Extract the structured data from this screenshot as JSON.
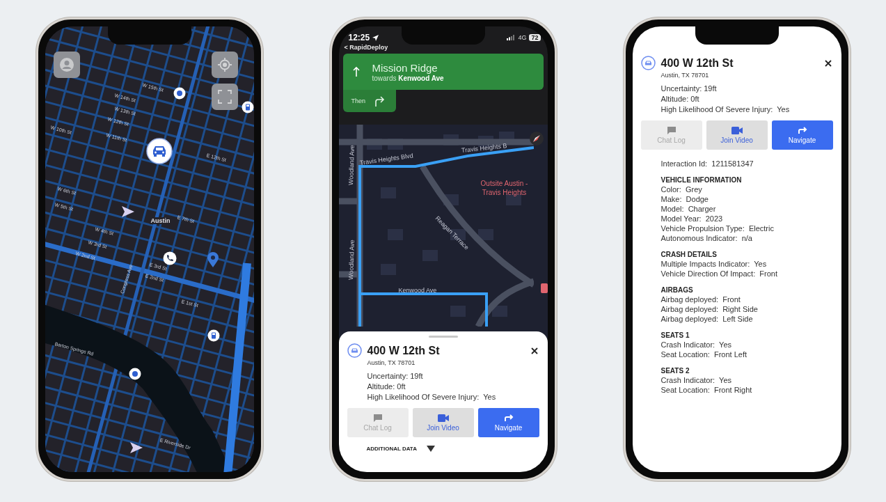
{
  "map_phone": {
    "controls": [
      {
        "kind": "profile"
      },
      {
        "kind": "locate"
      },
      {
        "kind": "fullscreen"
      }
    ],
    "markers": [
      {
        "kind": "fuel"
      },
      {
        "kind": "dot"
      },
      {
        "kind": "car"
      },
      {
        "kind": "arrow"
      },
      {
        "kind": "phone"
      },
      {
        "kind": "pin"
      },
      {
        "kind": "fuel"
      },
      {
        "kind": "dot"
      },
      {
        "kind": "arrow"
      }
    ],
    "street_labels": [
      "W 15th St",
      "W 14th St",
      "W 13th St",
      "W 12th St",
      "W 11th St",
      "W 10th St",
      "W 6th St",
      "W 5th St",
      "Austin",
      "E 7th St",
      "W 4th St",
      "W 3rd St",
      "W 2nd St",
      "E 3rd St",
      "E 2nd St",
      "E 1st St",
      "E 12th St",
      "Congress Ave",
      "Barton Springs Rd",
      "E Riverside Dr"
    ]
  },
  "navigation_phone": {
    "status_bar": {
      "time": "12:25",
      "network": "4G",
      "battery": "72"
    },
    "back_link": "< RapidDeploy",
    "maneuver": {
      "street": "Mission Ridge",
      "towards": "towards **Kenwood Ave**"
    },
    "next_maneuver": {
      "label": "Then"
    },
    "map_labels": [
      "Travis Heights Blvd",
      "Travis Heights B",
      "Woodland Ave",
      "Woodland Ave",
      "Reagan Terrace",
      "Outsite Austin - Travis Heights",
      "Kenwood Ave"
    ],
    "sheet": {
      "title": "400 W 12th St",
      "subtitle": "Austin, TX 78701",
      "details": [
        "Uncertainty: 19ft",
        "Altitude: 0ft",
        "High Likelihood Of Severe Injury:  Yes"
      ],
      "buttons": [
        {
          "kind": "chat",
          "label": "Chat Log",
          "disabled": true
        },
        {
          "kind": "video",
          "label": "Join Video",
          "disabled": false
        },
        {
          "kind": "navigate",
          "label": "Navigate",
          "disabled": false
        }
      ],
      "additional_data": {
        "label": "ADDITIONAL DATA",
        "expanded": false
      }
    }
  },
  "details_phone": {
    "card": {
      "title": "400 W 12th St",
      "subtitle": "Austin, TX 78701",
      "details": [
        "Uncertainty: 19ft",
        "Altitude: 0ft",
        "High Likelihood Of Severe Injury:  Yes"
      ],
      "buttons": [
        {
          "kind": "chat",
          "label": "Chat Log",
          "disabled": true
        },
        {
          "kind": "video",
          "label": "Join Video",
          "disabled": false
        },
        {
          "kind": "navigate",
          "label": "Navigate",
          "disabled": false
        }
      ]
    },
    "interaction_id": "Interaction Id:  1211581347",
    "sections": [
      {
        "heading": "VEHICLE INFORMATION",
        "lines": [
          "Color:  Grey",
          "Make:  Dodge",
          "Model:  Charger",
          "Model Year:  2023",
          "Vehicle Propulsion Type:  Electric",
          "Autonomous Indicator:  n/a"
        ]
      },
      {
        "heading": "CRASH DETAILS",
        "lines": [
          "Multiple Impacts Indicator:  Yes",
          "Vehicle Direction Of Impact:  Front"
        ]
      },
      {
        "heading": "AIRBAGS",
        "lines": [
          "Airbag deployed:  Front",
          "Airbag deployed:  Right Side",
          "Airbag deployed:  Left Side"
        ]
      },
      {
        "heading": "SEATS 1",
        "lines": [
          "Crash Indicator:  Yes",
          "Seat Location:  Front Left"
        ]
      },
      {
        "heading": "SEATS 2",
        "lines": [
          "Crash Indicator:  Yes",
          "Seat Location:  Front Right"
        ]
      }
    ]
  }
}
